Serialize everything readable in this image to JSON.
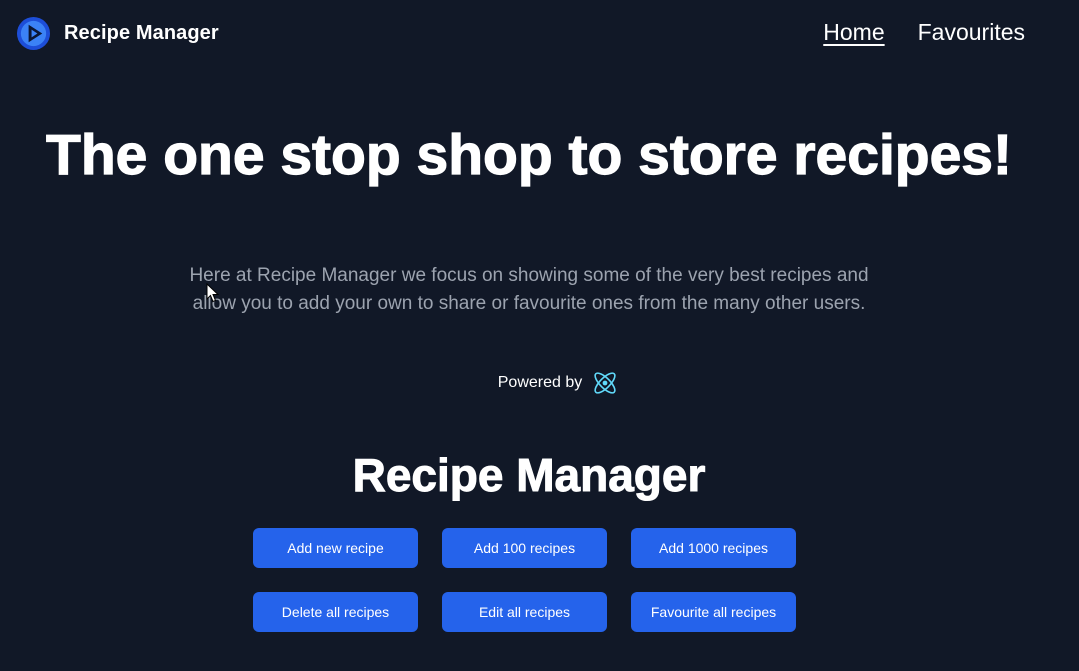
{
  "header": {
    "brand_name": "Recipe Manager",
    "logo_icon": "recipe-manager-logo",
    "nav": [
      {
        "label": "Home",
        "active": true
      },
      {
        "label": "Favourites",
        "active": false
      }
    ]
  },
  "hero": {
    "title": "The one stop shop to store recipes!",
    "subtitle": "Here at Recipe Manager we focus on showing some of the very best recipes and allow you to add your own to share or favourite ones from the many other users.",
    "powered_by": "Powered by",
    "powered_icon": "react-icon"
  },
  "manager": {
    "title": "Recipe Manager",
    "buttons": [
      "Add new recipe",
      "Add 100 recipes",
      "Add 1000 recipes",
      "Delete all recipes",
      "Edit all recipes",
      "Favourite all recipes"
    ]
  },
  "colors": {
    "background": "#111827",
    "button": "#2563eb",
    "subtitle_text": "#9ca3af",
    "accent_logo": "#1d4ed8",
    "react": "#61dafb"
  }
}
